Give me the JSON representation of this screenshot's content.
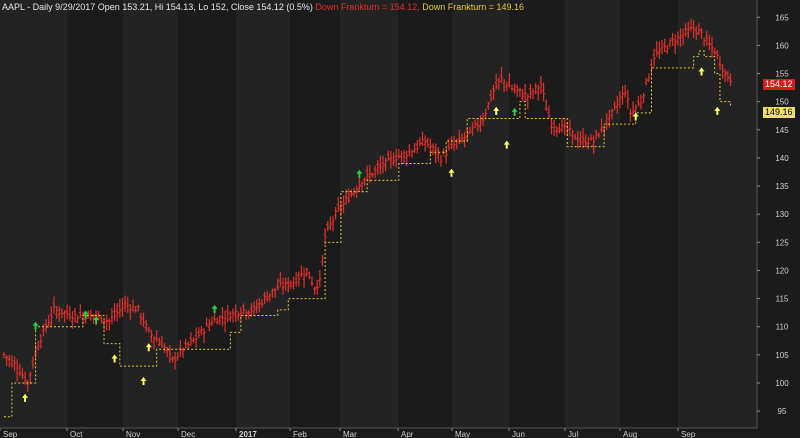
{
  "header": {
    "symbol_info": "AAPL - Daily 9/29/2017 Open 153.21, Hi 154.13, Lo 152, Close 154.12 (0.5%)",
    "indicator_label": "Down Frankturn = 154.12,",
    "stop_label": "Down Frankturn = 149.16"
  },
  "price_boxes": {
    "close": "154.12",
    "stop": "149.16"
  },
  "colors": {
    "background": "#1b1b1b",
    "band": "#232323",
    "bars": "#e0302b",
    "stop_line": "#e8c63c",
    "up_arrow": "#ffff66",
    "green_arrow": "#2ecc40",
    "axis_text": "#d0d0d0"
  },
  "chart_data": {
    "type": "ohlc",
    "x_labels": [
      "Sep",
      "Oct",
      "Nov",
      "Dec",
      "2017",
      "Feb",
      "Mar",
      "Apr",
      "May",
      "Jun",
      "Jul",
      "Aug",
      "Sep"
    ],
    "y_ticks": [
      95,
      100,
      105,
      110,
      115,
      120,
      125,
      130,
      135,
      140,
      145,
      150,
      155,
      160,
      165
    ],
    "ylim": [
      92,
      167
    ],
    "grid": false,
    "series": [
      {
        "kind": "close_path",
        "points": [
          [
            0,
            105
          ],
          [
            5,
            103
          ],
          [
            9,
            100
          ],
          [
            13,
            107
          ],
          [
            19,
            113
          ],
          [
            26,
            112
          ],
          [
            34,
            112
          ],
          [
            40,
            111
          ],
          [
            46,
            114
          ],
          [
            51,
            113
          ],
          [
            55,
            109
          ],
          [
            60,
            107
          ],
          [
            64,
            104
          ],
          [
            68,
            106
          ],
          [
            73,
            108
          ],
          [
            79,
            111
          ],
          [
            85,
            112
          ],
          [
            90,
            113
          ],
          [
            95,
            113
          ],
          [
            99,
            115
          ],
          [
            104,
            117
          ],
          [
            110,
            118
          ],
          [
            115,
            120
          ],
          [
            118,
            117
          ],
          [
            120,
            118
          ],
          [
            122,
            126
          ],
          [
            126,
            130
          ],
          [
            131,
            133
          ],
          [
            136,
            136
          ],
          [
            142,
            138
          ],
          [
            148,
            140
          ],
          [
            154,
            141
          ],
          [
            160,
            143
          ],
          [
            166,
            140
          ],
          [
            170,
            142
          ],
          [
            176,
            144
          ],
          [
            182,
            147
          ],
          [
            186,
            152
          ],
          [
            189,
            154
          ],
          [
            194,
            152
          ],
          [
            199,
            151
          ],
          [
            204,
            153
          ],
          [
            206,
            149
          ],
          [
            208,
            146
          ],
          [
            214,
            145
          ],
          [
            219,
            143
          ],
          [
            224,
            143
          ],
          [
            230,
            147
          ],
          [
            236,
            152
          ],
          [
            238,
            148
          ],
          [
            242,
            150
          ],
          [
            247,
            158
          ],
          [
            252,
            160
          ],
          [
            258,
            162
          ],
          [
            262,
            163
          ],
          [
            265,
            162
          ],
          [
            268,
            160
          ],
          [
            270,
            159
          ],
          [
            272,
            157
          ],
          [
            274,
            155
          ],
          [
            276,
            154
          ]
        ]
      },
      {
        "kind": "stop_line",
        "points": [
          [
            0,
            94
          ],
          [
            3,
            100
          ],
          [
            10,
            100
          ],
          [
            12,
            110
          ],
          [
            28,
            110
          ],
          [
            30,
            112
          ],
          [
            38,
            107
          ],
          [
            44,
            103
          ],
          [
            56,
            103
          ],
          [
            58,
            106
          ],
          [
            86,
            109
          ],
          [
            90,
            112
          ],
          [
            104,
            113
          ],
          [
            108,
            115
          ],
          [
            122,
            125
          ],
          [
            128,
            134
          ],
          [
            138,
            136
          ],
          [
            150,
            139
          ],
          [
            162,
            141
          ],
          [
            168,
            143
          ],
          [
            176,
            147
          ],
          [
            196,
            150
          ],
          [
            198,
            147
          ],
          [
            214,
            142
          ],
          [
            226,
            142
          ],
          [
            228,
            146
          ],
          [
            240,
            148
          ],
          [
            246,
            156
          ],
          [
            256,
            156
          ],
          [
            262,
            158
          ],
          [
            264,
            159
          ],
          [
            266,
            158
          ],
          [
            270,
            155
          ],
          [
            272,
            150
          ],
          [
            276,
            149
          ]
        ]
      }
    ],
    "up_arrows": [
      [
        8,
        97
      ],
      [
        42,
        104
      ],
      [
        53,
        100
      ],
      [
        55,
        106
      ],
      [
        170,
        137
      ],
      [
        187,
        148
      ],
      [
        191,
        142
      ],
      [
        240,
        147
      ],
      [
        265,
        155
      ],
      [
        271,
        148
      ]
    ],
    "green_arrows": [
      [
        12,
        110
      ],
      [
        31,
        112
      ],
      [
        35,
        111
      ],
      [
        80,
        113
      ],
      [
        135,
        137
      ],
      [
        194,
        148
      ]
    ]
  }
}
